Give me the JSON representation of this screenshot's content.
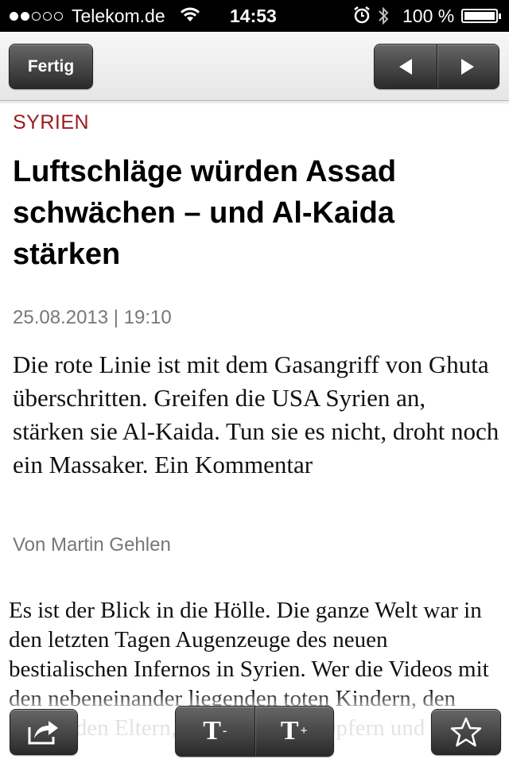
{
  "status_bar": {
    "carrier": "Telekom.de",
    "time": "14:53",
    "battery_percent": "100 %",
    "signal_bars_filled": 2,
    "signal_bars_total": 5
  },
  "nav": {
    "done_label": "Fertig",
    "prev_icon": "left-arrow-icon",
    "next_icon": "right-arrow-icon"
  },
  "article": {
    "section": "SYRIEN",
    "headline": "Luftschläge würden Assad schwächen – und Al-Kaida stärken",
    "date": "25.08.2013 | 19:10",
    "lead": "Die rote Linie ist mit dem Gasangriff von Ghuta überschritten. Greifen die USA Syrien an, stärken sie Al-Kaida. Tun sie es nicht, droht noch ein Massaker. Ein Kommentar",
    "author": "Von Martin Gehlen",
    "body": "Es ist der Blick in die Hölle. Die ganze Welt war in den letzten Tagen Augenzeuge des neuen bestialischen Infernos in Syrien. Wer die Videos mit den nebeneinander liegenden toten Kindern, den weinenden Eltern, den zitternden Opfern und deren"
  },
  "toolbar": {
    "decrease_font_label": "T",
    "decrease_font_sup": "-",
    "increase_font_label": "T",
    "increase_font_sup": "+",
    "share_icon": "share-icon",
    "favorite_icon": "star-icon"
  },
  "colors": {
    "section": "#9b1b1b",
    "status_bar_bg": "#000000",
    "button_dark": "#3a3a3a"
  }
}
